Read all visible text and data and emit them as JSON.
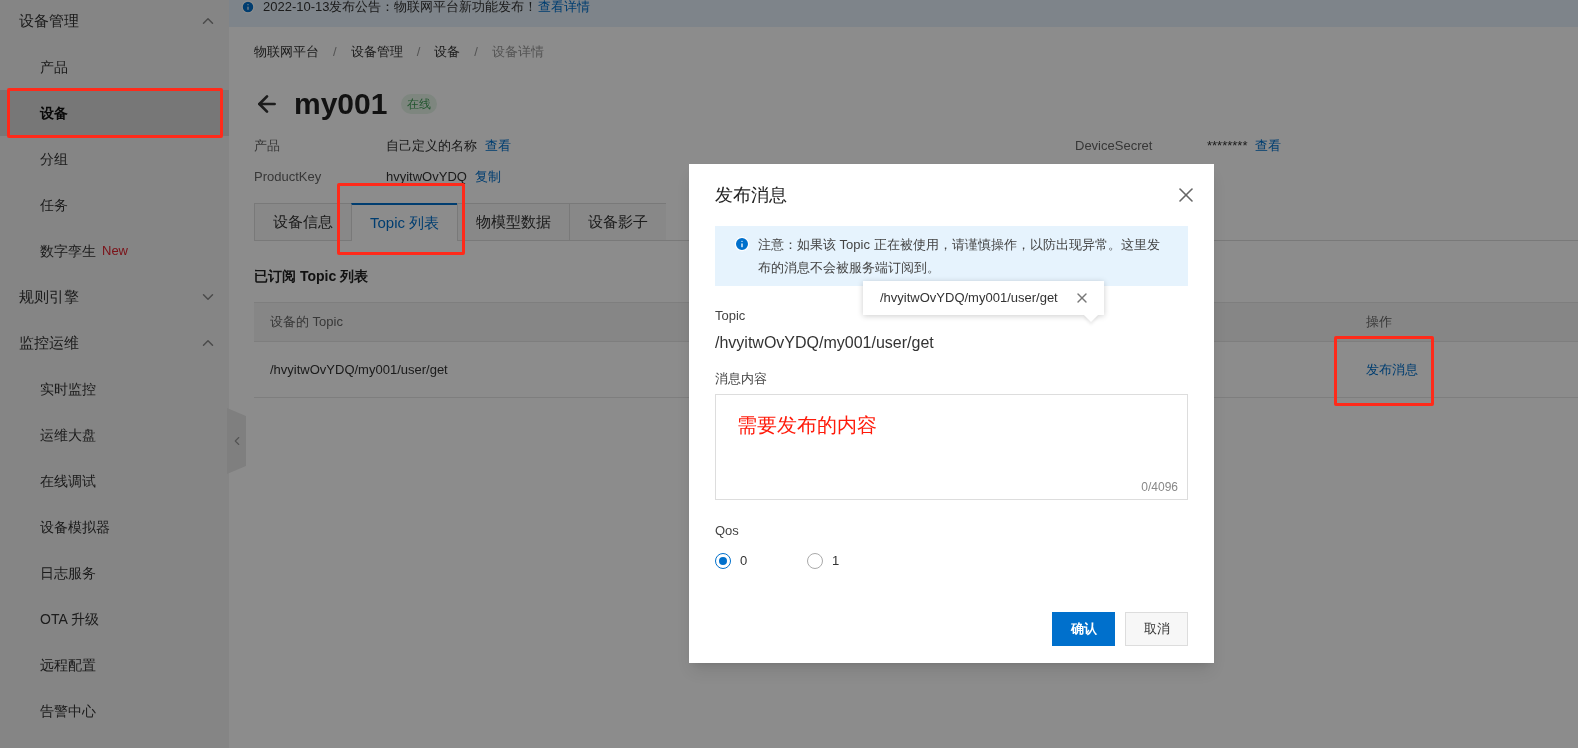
{
  "banner": {
    "text": "2022-10-13发布公告：物联网平台新功能发布！",
    "link": "查看详情"
  },
  "sidebar": {
    "groups": [
      {
        "label": "设备管理",
        "expanded": true,
        "items": [
          {
            "label": "产品",
            "selected": false,
            "annotated": false
          },
          {
            "label": "设备",
            "selected": true,
            "annotated": true
          },
          {
            "label": "分组",
            "selected": false,
            "annotated": false
          },
          {
            "label": "任务",
            "selected": false,
            "annotated": false
          },
          {
            "label": "数字孪生",
            "badge": "New",
            "selected": false,
            "annotated": false
          }
        ]
      },
      {
        "label": "规则引擎",
        "expanded": false
      },
      {
        "label": "监控运维",
        "expanded": true,
        "items": [
          {
            "label": "实时监控",
            "selected": false,
            "annotated": false
          },
          {
            "label": "运维大盘",
            "selected": false,
            "annotated": false
          },
          {
            "label": "在线调试",
            "selected": false,
            "annotated": false
          },
          {
            "label": "设备模拟器",
            "selected": false,
            "annotated": false
          },
          {
            "label": "日志服务",
            "selected": false,
            "annotated": false
          },
          {
            "label": "OTA 升级",
            "selected": false,
            "annotated": false
          },
          {
            "label": "远程配置",
            "selected": false,
            "annotated": false
          },
          {
            "label": "告警中心",
            "selected": false,
            "annotated": false
          }
        ]
      }
    ]
  },
  "breadcrumb": [
    {
      "label": "物联网平台"
    },
    {
      "separator": "/",
      "label": "设备管理"
    },
    {
      "separator": "/",
      "label": "设备"
    },
    {
      "separator": "/",
      "label": "设备详情"
    }
  ],
  "device": {
    "name": "my001",
    "status": "在线"
  },
  "info": [
    {
      "label": "产品",
      "value": "自己定义的名称",
      "action": "查看"
    },
    {
      "label": "DeviceSecret",
      "value": "********",
      "action": "查看"
    },
    {
      "label": "ProductKey",
      "value": "hvyitwOvYDQ",
      "action": "复制"
    }
  ],
  "tabs": [
    {
      "label": "设备信息",
      "selected": false,
      "annotated": false
    },
    {
      "label": "Topic 列表",
      "selected": true,
      "annotated": true
    },
    {
      "label": "物模型数据",
      "selected": false,
      "annotated": false
    },
    {
      "label": "设备影子",
      "selected": false,
      "annotated": false
    }
  ],
  "section_title": "已订阅 Topic 列表",
  "table": {
    "columns": [
      "设备的 Topic",
      "操作"
    ],
    "rows": [
      {
        "topic": "/hvyitwOvYDQ/my001/user/get",
        "action": "发布消息",
        "annotated": true
      }
    ]
  },
  "dialog": {
    "title": "发布消息",
    "alert": "注意：如果该 Topic 正在被使用，请谨慎操作，以防出现异常。这里发布的消息不会被服务端订阅到。",
    "tooltip": "/hvyitwOvYDQ/my001/user/get",
    "topic_label": "Topic",
    "topic_value": "/hvyitwOvYDQ/my001/user/get",
    "message_label": "消息内容",
    "message_note": "需要发布的内容",
    "counter": "0/4096",
    "qos_label": "Qos",
    "qos_options": [
      {
        "label": "0",
        "selected": true
      },
      {
        "label": "1",
        "selected": false
      }
    ],
    "buttons": [
      {
        "label": "确认",
        "kind": "primary"
      },
      {
        "label": "取消",
        "kind": "secondary"
      }
    ]
  }
}
